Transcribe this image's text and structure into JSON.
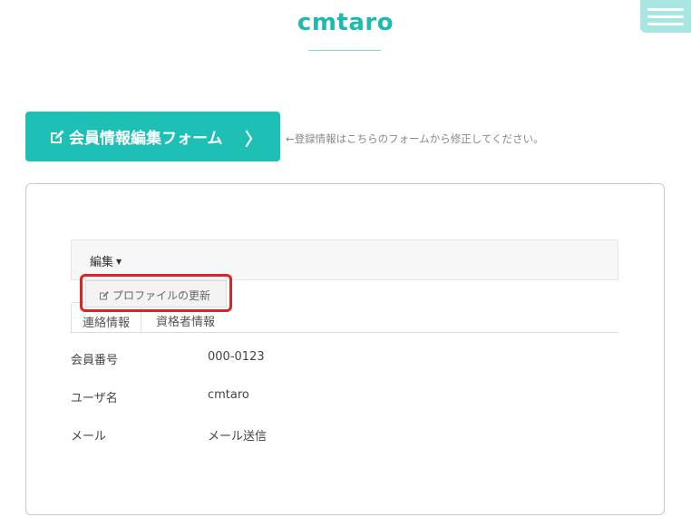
{
  "header": {
    "site_title": "cmtaro",
    "menu_icon": "hamburger-menu-icon"
  },
  "form_link": {
    "label": "会員情報編集フォーム",
    "chevron": "〉",
    "hint": "←登録情報はこちらのフォームから修正してください。",
    "icon": "edit-icon"
  },
  "edit_menu": {
    "toggle_label": "編集",
    "caret": "▼",
    "items": [
      {
        "label": "プロファイルの更新",
        "icon": "edit-icon"
      }
    ]
  },
  "tabs": [
    {
      "label": "連絡情報",
      "active": true
    },
    {
      "label": "資格者情報",
      "active": false
    }
  ],
  "profile_rows": [
    {
      "label": "会員番号",
      "value": "000-0123"
    },
    {
      "label": "ユーザ名",
      "value": "cmtaro"
    },
    {
      "label": "メール",
      "value": "メール送信"
    }
  ],
  "colors": {
    "accent": "#1ec0b5",
    "title": "#1fb9b0",
    "highlight": "#d92525"
  }
}
